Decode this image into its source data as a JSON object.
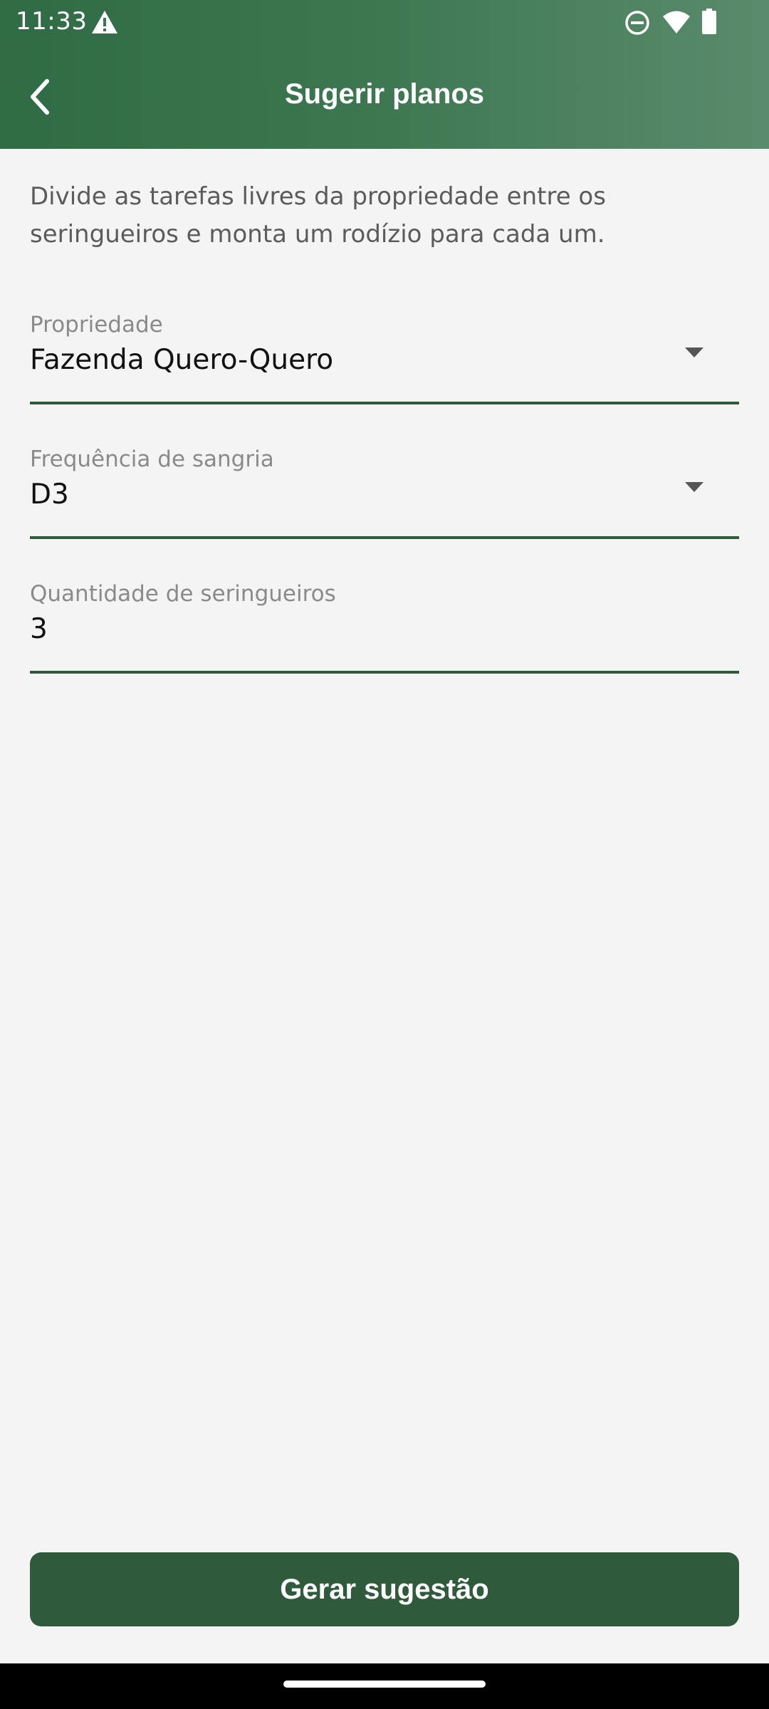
{
  "status_bar": {
    "time": "11:33",
    "icons": [
      "warning-icon",
      "do-not-disturb-icon",
      "wifi-icon",
      "battery-icon"
    ]
  },
  "app_bar": {
    "title": "Sugerir planos",
    "back_icon": "chevron-left-icon"
  },
  "description": "Divide as tarefas livres da propriedade entre os seringueiros e monta um rodízio para cada um.",
  "form": {
    "propriedade": {
      "label": "Propriedade",
      "value": "Fazenda Quero-Quero"
    },
    "frequencia": {
      "label": "Frequência de sangria",
      "value": "D3"
    },
    "quantidade": {
      "label": "Quantidade de seringueiros",
      "value": "3"
    }
  },
  "actions": {
    "generate_label": "Gerar sugestão"
  },
  "colors": {
    "header_start": "#2f6b44",
    "header_end": "#5a8b6c",
    "primary": "#2f5a3c",
    "background": "#f4f4f4"
  }
}
